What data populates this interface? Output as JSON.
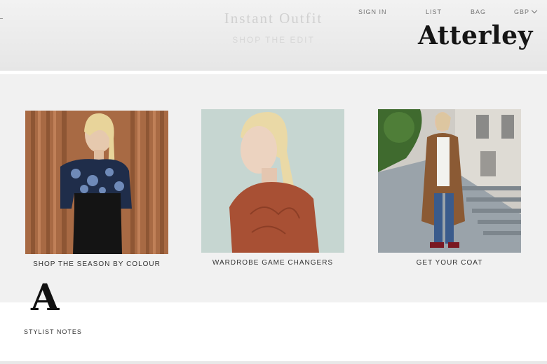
{
  "hero": {
    "title": "Instant Outfit",
    "subtitle": "SHOP THE EDIT"
  },
  "topnav": {
    "sign_in": "SIGN IN",
    "list": "LIST",
    "bag": "BAG",
    "currency": "GBP"
  },
  "brand": {
    "logo_text": "Atterley"
  },
  "tiles": [
    {
      "caption": "SHOP THE SEASON BY COLOUR"
    },
    {
      "caption": "WARDROBE GAME CHANGERS"
    },
    {
      "caption": "GET YOUR COAT"
    }
  ],
  "stylist": {
    "logo_letter": "A",
    "label": "STYLIST NOTES"
  },
  "icons": {
    "currency_dropdown": "chevron-down-icon"
  }
}
